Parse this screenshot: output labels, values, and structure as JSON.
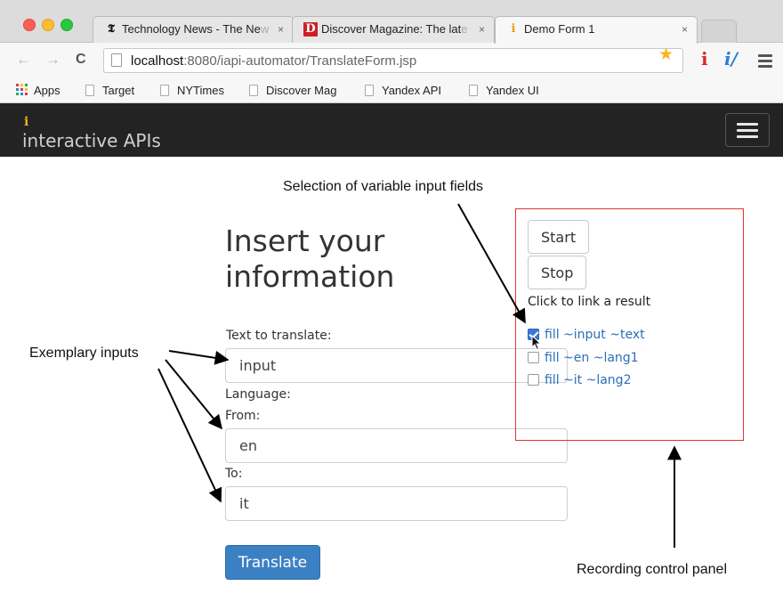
{
  "browser": {
    "tabs": [
      {
        "icon": "nytimes-favicon",
        "title": "Technology News - The Ne",
        "title_faded": "w"
      },
      {
        "icon": "discover-favicon",
        "title": "Discover Magazine: The lat",
        "title_faded": "e"
      },
      {
        "icon": "iapi-favicon",
        "title": "Demo Form 1"
      }
    ],
    "tab_close": "×",
    "url_host": "localhost",
    "url_rest": ":8080/iapi-automator/TranslateForm.jsp",
    "bookmarks": [
      "Apps",
      "Target",
      "NYTimes",
      "Discover Mag",
      "Yandex API",
      "Yandex UI"
    ]
  },
  "navbar": {
    "brand_glyph": "i",
    "brand": "interactive APIs"
  },
  "form": {
    "heading_line1": "Insert your",
    "heading_line2": "information",
    "text_label": "Text to translate:",
    "text_value": "input",
    "language_label": "Language:",
    "from_label": "From:",
    "from_value": "en",
    "to_label": "To:",
    "to_value": "it",
    "submit": "Translate"
  },
  "panel": {
    "start": "Start",
    "stop": "Stop",
    "hint": "Click to link a result",
    "options": [
      {
        "label": "fill ~input ~text",
        "checked": true
      },
      {
        "label": "fill ~en ~lang1",
        "checked": false
      },
      {
        "label": "fill ~it ~lang2",
        "checked": false
      }
    ]
  },
  "annotations": {
    "variable_fields": "Selection of variable input fields",
    "exemplary_inputs": "Exemplary inputs",
    "control_panel": "Recording control panel"
  },
  "colors": {
    "navbar_bg": "#232323",
    "brand_icon": "#f2b018",
    "primary_button": "#3c80c4",
    "panel_border": "#e3332f",
    "link_text": "#2a6fb8"
  }
}
